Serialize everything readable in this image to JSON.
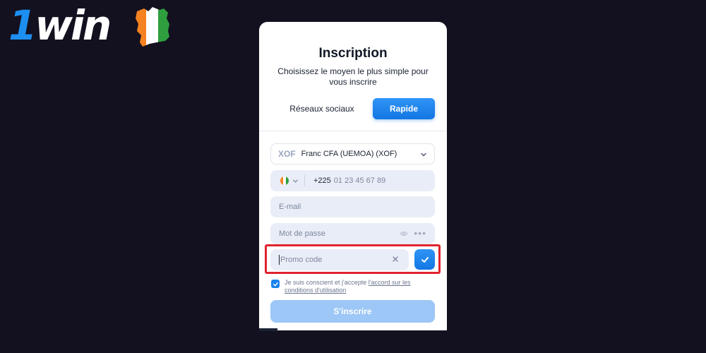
{
  "brand": {
    "logo_text_prefix": "1",
    "logo_text_rest": "win"
  },
  "modal": {
    "title": "Inscription",
    "subtitle": "Choisissez le moyen le plus simple pour vous inscrire",
    "tabs": [
      {
        "label": "Réseaux sociaux",
        "active": false
      },
      {
        "label": "Rapide",
        "active": true
      }
    ]
  },
  "form": {
    "currency": {
      "code": "XOF",
      "name": "Franc CFA (UEMOA) (XOF)"
    },
    "phone": {
      "country_flag": "ivory-coast-flag-icon",
      "prefix": "+225",
      "placeholder": "01 23 45 67 89"
    },
    "email": {
      "placeholder": "E-mail"
    },
    "password": {
      "placeholder": "Mot de passe"
    },
    "promo": {
      "placeholder": "Promo code"
    },
    "terms": {
      "checked": true,
      "text": "Je suis conscient et j'accepte ",
      "link": "l'accord sur les conditions d'utilisation"
    },
    "submit_label": "S'inscrire"
  },
  "colors": {
    "background": "#13111f",
    "accent": "#1a83ec",
    "highlight": "#e0232f"
  }
}
